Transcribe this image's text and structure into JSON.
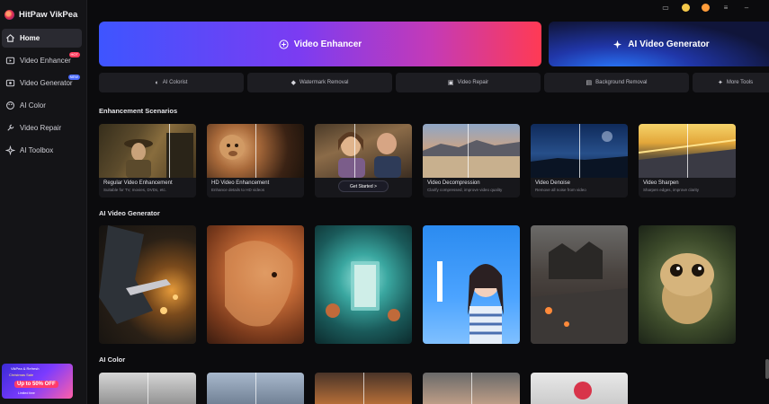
{
  "app": {
    "name": "HitPaw VikPea"
  },
  "sidebar": {
    "items": [
      {
        "label": "Home",
        "icon": "home-icon"
      },
      {
        "label": "Video Enhancer",
        "icon": "video-enhancer-icon",
        "badge": "HOT"
      },
      {
        "label": "Video Generator",
        "icon": "video-generator-icon",
        "badge": "NEW"
      },
      {
        "label": "AI Color",
        "icon": "palette-icon"
      },
      {
        "label": "Video Repair",
        "icon": "wrench-icon"
      },
      {
        "label": "AI Toolbox",
        "icon": "toolbox-icon"
      }
    ],
    "promo": {
      "line1": "VikPea & Refresh",
      "line2": "Christmas Sale",
      "line3": "Up to 50% OFF",
      "line4": "Limited time"
    }
  },
  "hero": {
    "enhancer_label": "Video Enhancer",
    "generator_label": "AI Video Generator"
  },
  "chips": [
    {
      "label": "AI Colorist",
      "icon": "palette-icon"
    },
    {
      "label": "Watermark Removal",
      "icon": "eraser-icon"
    },
    {
      "label": "Video Repair",
      "icon": "video-repair-icon"
    },
    {
      "label": "Background Removal",
      "icon": "background-removal-icon"
    },
    {
      "label": "More Tools",
      "icon": "more-tools-icon"
    }
  ],
  "sections": {
    "enhancement": "Enhancement Scenarios",
    "generator": "AI Video Generator",
    "color": "AI Color"
  },
  "enhancement_cards": [
    {
      "title": "Regular Video Enhancement",
      "desc": "Suitable for TV, movies, DVDs, etc."
    },
    {
      "title": "HD Video Enhancement",
      "desc": "Enhance details to HD videos"
    },
    {
      "title": "",
      "desc": "",
      "cta": "Get Started >"
    },
    {
      "title": "Video Decompression",
      "desc": "Clarify compressed, improve video quality"
    },
    {
      "title": "Video Denoise",
      "desc": "Remove all noise from video"
    },
    {
      "title": "Video Sharpen",
      "desc": "Sharpen edges, improve clarity"
    }
  ],
  "colors": {
    "accent_start": "#3e55ff",
    "accent_end": "#ff3a54",
    "background": "#0b0b0d",
    "sidebar": "#141417"
  }
}
